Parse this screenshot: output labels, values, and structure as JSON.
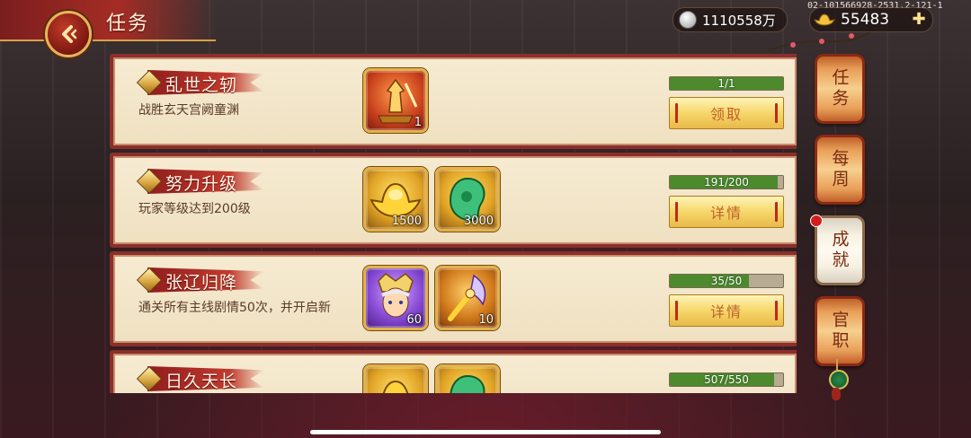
{
  "header": {
    "title": "任务",
    "back_icon": "chevron-left-icon",
    "build_id": "02-101566928-2531.2-121-1"
  },
  "resources": {
    "silver": {
      "icon": "silver-coin-icon",
      "value": "1110558万"
    },
    "gold": {
      "icon": "gold-ingot-icon",
      "value": "55483",
      "add_icon": "plus-icon"
    }
  },
  "tasks": [
    {
      "title": "乱世之轫",
      "desc": "战胜玄天宫阙童渊",
      "progress_text": "1/1",
      "progress": 1.0,
      "button": "领取",
      "rewards": [
        {
          "icon": "warrior-statue-icon",
          "count": "1",
          "bg": "red"
        }
      ]
    },
    {
      "title": "努力升级",
      "desc": "玩家等级达到200级",
      "progress_text": "191/200",
      "progress": 0.955,
      "button": "详情",
      "rewards": [
        {
          "icon": "gold-ingot-icon",
          "count": "1500",
          "bg": "yellow"
        },
        {
          "icon": "jade-icon",
          "count": "3000",
          "bg": "yellow"
        }
      ]
    },
    {
      "title": "张辽归降",
      "desc": "通关所有主线剧情50次，并开启新",
      "progress_text": "35/50",
      "progress": 0.7,
      "button": "详情",
      "rewards": [
        {
          "icon": "general-portrait-icon",
          "count": "60",
          "bg": "purple"
        },
        {
          "icon": "golden-weapon-icon",
          "count": "10",
          "bg": "orange"
        }
      ]
    },
    {
      "title": "日久天长",
      "desc": "",
      "progress_text": "507/550",
      "progress": 0.922,
      "button": "",
      "rewards": [
        {
          "icon": "gold-ingot-icon",
          "count": "",
          "bg": "yellow"
        },
        {
          "icon": "jade-icon",
          "count": "",
          "bg": "yellow"
        }
      ]
    }
  ],
  "side_tabs": [
    {
      "label": "任务",
      "active": false
    },
    {
      "label": "每周",
      "active": false
    },
    {
      "label": "成就",
      "active": true,
      "badge": true
    },
    {
      "label": "官职",
      "active": false
    }
  ],
  "colors": {
    "progress_fill": "#4d8a2e",
    "card_border": "#8a2f2c",
    "accent_gold": "#e2b24b"
  }
}
